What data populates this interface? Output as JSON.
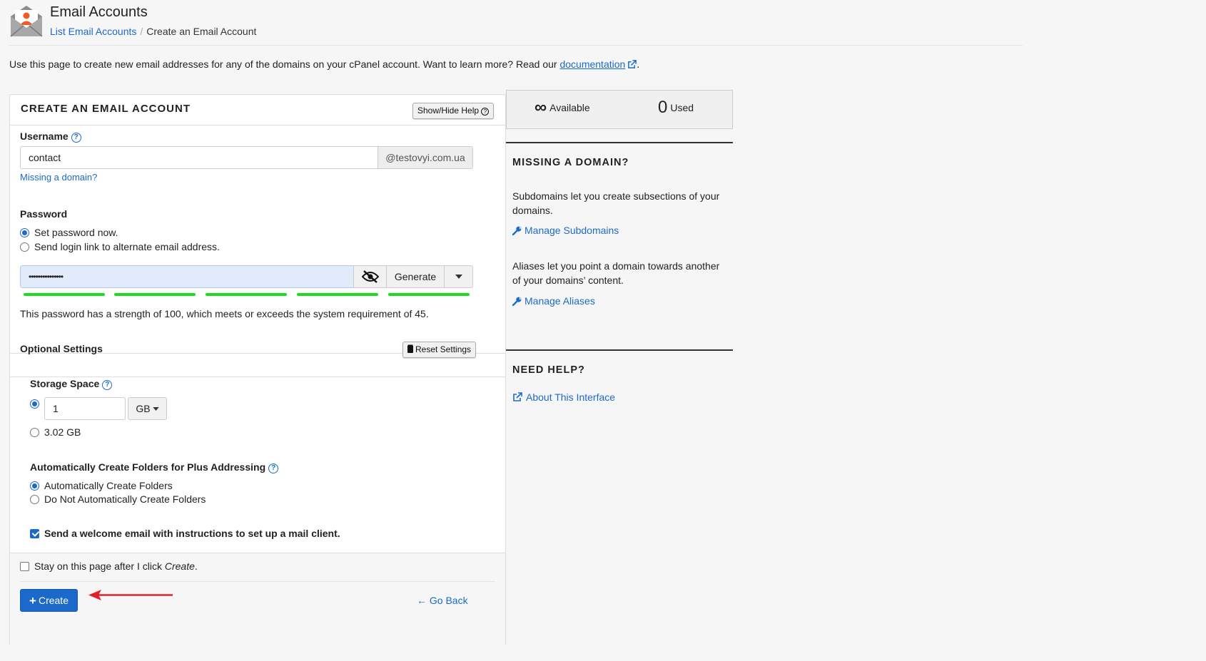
{
  "header": {
    "title": "Email Accounts",
    "breadcrumb_link": "List Email Accounts",
    "breadcrumb_current": "Create an Email Account"
  },
  "intro": {
    "text": "Use this page to create new email addresses for any of the domains on your cPanel account. Want to learn more? Read our",
    "link": "documentation",
    "trailing": "."
  },
  "form": {
    "title": "CREATE AN EMAIL ACCOUNT",
    "help_button": "Show/Hide Help",
    "username_label": "Username",
    "username_value": "contact",
    "domain_suffix": "@testovyi.com.ua",
    "missing_domain_link": "Missing a domain?",
    "password_label": "Password",
    "password_option_now": "Set password now.",
    "password_option_link": "Send login link to alternate email address.",
    "password_value": "•••••••••••••••",
    "generate_button": "Generate",
    "strength_text": "This password has a strength of 100, which meets or exceeds the system requirement of 45.",
    "strength_value": 100,
    "optional_title": "Optional Settings",
    "reset_button": "Reset Settings",
    "storage_label": "Storage Space",
    "storage_value": "1",
    "storage_unit": "GB",
    "storage_alt": "3.02 GB",
    "plus_label": "Automatically Create Folders for Plus Addressing",
    "plus_option_auto": "Automatically Create Folders",
    "plus_option_no": "Do Not Automatically Create Folders",
    "welcome_text": "Send a welcome email with instructions to set up a mail client.",
    "stay_text": "Stay on this page after I click",
    "stay_em": "Create",
    "stay_dot": ".",
    "create_button": "Create",
    "go_back": "Go Back"
  },
  "sidebar": {
    "available_symbol": "∞",
    "available_label": "Available",
    "used_value": "0",
    "used_label": "Used",
    "missing_title": "MISSING A DOMAIN?",
    "subdomains_text": "Subdomains let you create subsections of your domains.",
    "subdomains_link": "Manage Subdomains",
    "aliases_text": "Aliases let you point a domain towards another of your domains’ content.",
    "aliases_link": "Manage Aliases",
    "help_title": "NEED HELP?",
    "about_link": "About This Interface"
  },
  "colors": {
    "accent": "#1b6ac9",
    "strength": "#1bdd1b",
    "arrow": "#e0202a",
    "password_bg": "#e1ebfb"
  }
}
